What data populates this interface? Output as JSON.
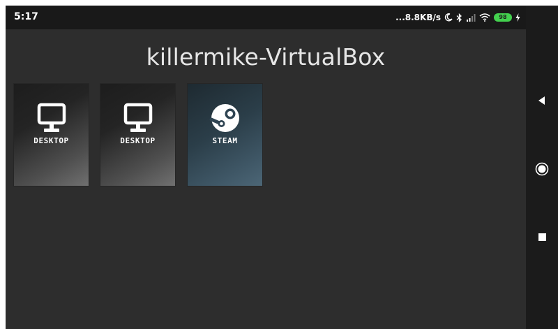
{
  "status_bar": {
    "time": "5:17",
    "net_speed": "...8.8KB/s",
    "battery_level": "98",
    "icons": [
      "moon-icon",
      "bluetooth-icon",
      "cell-signal-icon",
      "wifi-icon",
      "battery-icon",
      "charging-icon"
    ]
  },
  "main": {
    "host_title": "killermike-VirtualBox",
    "tiles": [
      {
        "label": "DESKTOP",
        "icon": "monitor-icon"
      },
      {
        "label": "DESKTOP",
        "icon": "monitor-icon"
      },
      {
        "label": "STEAM",
        "icon": "steam-icon"
      }
    ]
  },
  "nav_bar": {
    "buttons": [
      "back-icon",
      "home-icon",
      "recents-icon"
    ]
  },
  "colors": {
    "background": "#2d2d2d",
    "status_bar": "#191919",
    "nav_bar": "#1b1b1b",
    "battery": "#43d14e",
    "title_text": "#e6e6e6"
  }
}
